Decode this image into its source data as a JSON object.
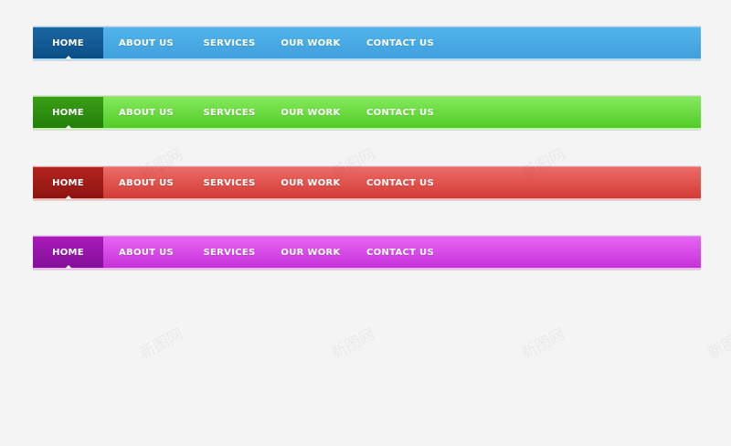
{
  "navbars": [
    {
      "id": "blue",
      "colors": {
        "bar": "#47a9e6",
        "active": "#0f5590"
      },
      "items": [
        {
          "label": "HOME"
        },
        {
          "label": "ABOUT US"
        },
        {
          "label": "SERVICES"
        },
        {
          "label": "OUR WORK"
        },
        {
          "label": "CONTACT US"
        }
      ]
    },
    {
      "id": "green",
      "colors": {
        "bar": "#67dc3a",
        "active": "#2d8a0f"
      },
      "items": [
        {
          "label": "HOME"
        },
        {
          "label": "ABOUT US"
        },
        {
          "label": "SERVICES"
        },
        {
          "label": "OUR WORK"
        },
        {
          "label": "CONTACT US"
        }
      ]
    },
    {
      "id": "red",
      "colors": {
        "bar": "#df4c47",
        "active": "#9e1b16"
      },
      "items": [
        {
          "label": "HOME"
        },
        {
          "label": "ABOUT US"
        },
        {
          "label": "SERVICES"
        },
        {
          "label": "OUR WORK"
        },
        {
          "label": "CONTACT US"
        }
      ]
    },
    {
      "id": "purple",
      "colors": {
        "bar": "#d644e6",
        "active": "#9212a6"
      },
      "items": [
        {
          "label": "HOME"
        },
        {
          "label": "ABOUT US"
        },
        {
          "label": "SERVICES"
        },
        {
          "label": "OUR WORK"
        },
        {
          "label": "CONTACT US"
        }
      ]
    }
  ],
  "watermark": {
    "text": "新图网"
  }
}
